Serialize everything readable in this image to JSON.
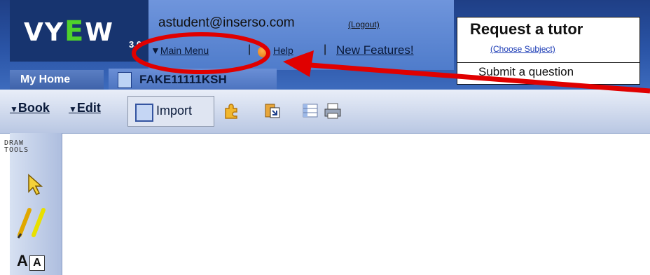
{
  "header": {
    "logo": {
      "text_left": "VY",
      "text_e": "E",
      "text_right": "W",
      "version": "3.0"
    },
    "user_email": "astudent@inserso.com",
    "logout_label": "(Logout)",
    "main_menu_label": "Main Menu",
    "menu_arrow": "▼",
    "separator": "|",
    "help_label": "Help",
    "new_features_label": "New Features!"
  },
  "tutor_box": {
    "title": "Request a tutor",
    "choose_subject": "(Choose Subject)",
    "submit_question": "Submit a question"
  },
  "tabs": {
    "home_label": "My Home",
    "book_title": "FAKE11111KSH"
  },
  "toolbar": {
    "book_label": "Book",
    "edit_label": "Edit",
    "menu_arrow": "▼",
    "import_label": "Import",
    "icons": [
      "puzzle-icon",
      "paste-icon",
      "table-icon",
      "print-icon"
    ]
  },
  "draw_tools": {
    "label_line1": "DRAW",
    "label_line2": "TOOLS",
    "text_tool_a": "A",
    "text_tool_box": "A"
  },
  "colors": {
    "header_blue": "#2a54a6",
    "annotation_red": "#e00000",
    "logo_green": "#4fd12b"
  }
}
